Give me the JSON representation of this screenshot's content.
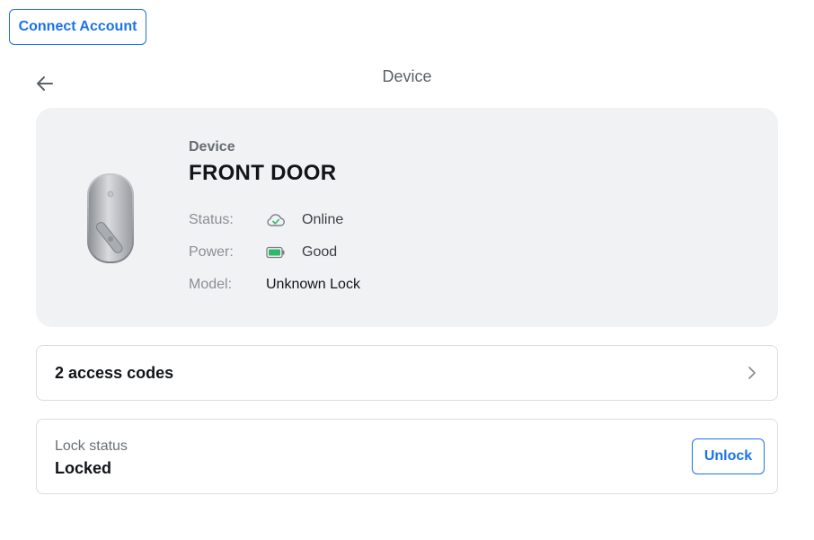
{
  "header": {
    "connect_button": "Connect Account",
    "back_icon": "arrow-left-icon",
    "title": "Device"
  },
  "device": {
    "section_label": "Device",
    "name": "FRONT DOOR",
    "image": "smart-lock-image",
    "status": {
      "key": "Status:",
      "icon": "cloud-check-icon",
      "value": "Online"
    },
    "power": {
      "key": "Power:",
      "icon": "battery-icon",
      "value": "Good"
    },
    "model": {
      "key": "Model:",
      "value": "Unknown Lock"
    }
  },
  "access_codes": {
    "label": "2 access codes",
    "icon": "chevron-right-icon"
  },
  "lock_status": {
    "label": "Lock status",
    "value": "Locked",
    "action": "Unlock"
  },
  "colors": {
    "accent": "#1a73e8",
    "card_bg": "#f1f2f4",
    "online": "#2fb86a",
    "battery": "#2fb86a"
  }
}
